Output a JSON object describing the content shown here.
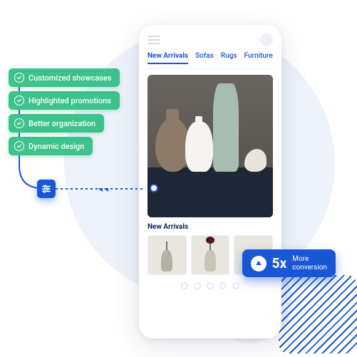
{
  "colors": {
    "accent": "#1956d6",
    "success": "#3cc28a"
  },
  "features": [
    {
      "label": "Customized showcases"
    },
    {
      "label": "Highlighted promotions"
    },
    {
      "label": "Better organization"
    },
    {
      "label": "Dynamic design"
    }
  ],
  "phone": {
    "tabs": [
      {
        "label": "New Arrivals",
        "active": true
      },
      {
        "label": "Sofas",
        "active": false
      },
      {
        "label": "Rugs",
        "active": false
      },
      {
        "label": "Furniture",
        "active": false
      }
    ],
    "section_title": "New Arrivals"
  },
  "stat": {
    "value": "5x",
    "line1": "More",
    "line2": "conversion"
  }
}
